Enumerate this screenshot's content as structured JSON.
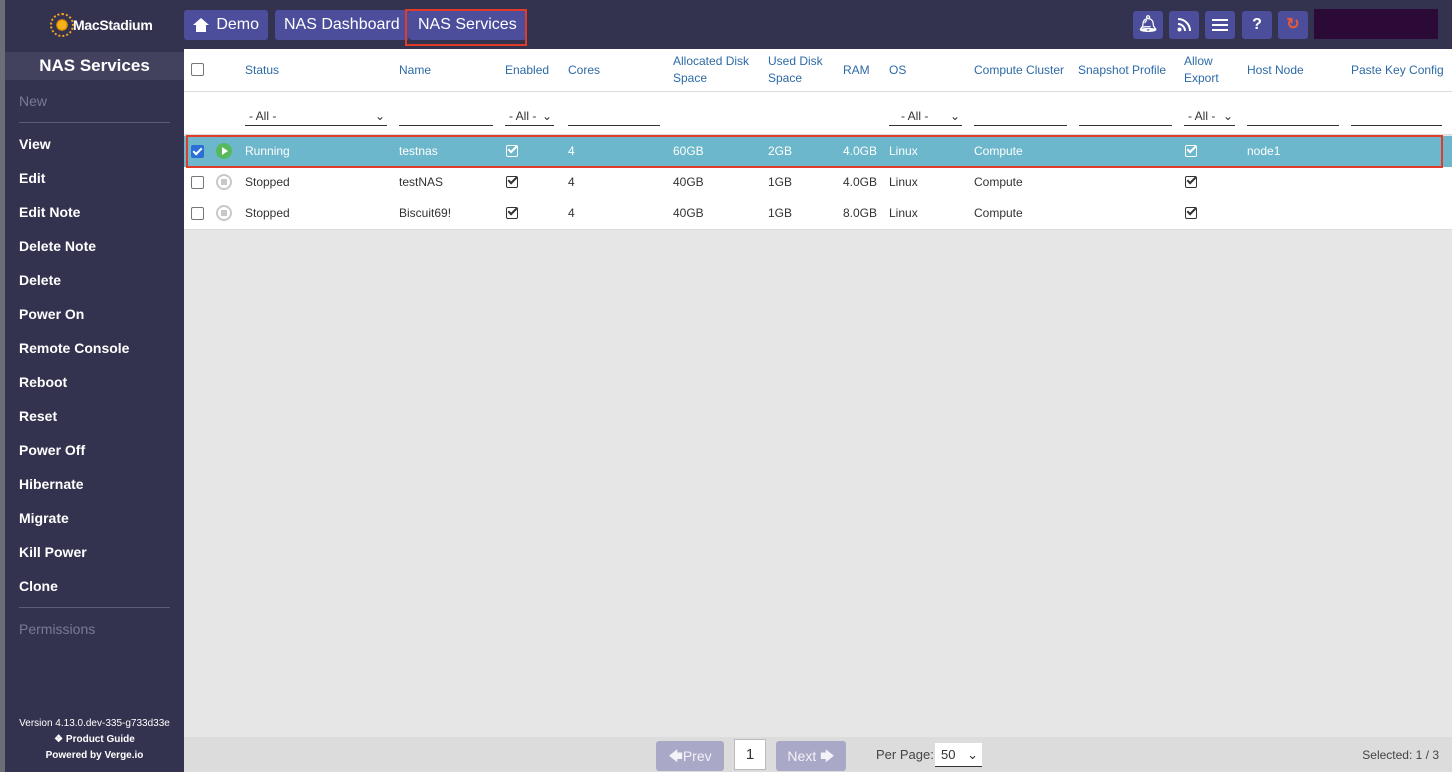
{
  "app": {
    "logo_text": "MacStadium"
  },
  "sidebar": {
    "title": "NAS Services",
    "new_label": "New",
    "items": [
      "View",
      "Edit",
      "Edit Note",
      "Delete Note",
      "Delete",
      "Power On",
      "Remote Console",
      "Reboot",
      "Reset",
      "Power Off",
      "Hibernate",
      "Migrate",
      "Kill Power",
      "Clone"
    ],
    "permissions_label": "Permissions",
    "version": "Version 4.13.0.dev-335-g733d33e",
    "product_guide": "Product Guide",
    "powered_by": "Powered by Verge.io"
  },
  "breadcrumbs": {
    "home": "Demo",
    "dashboard": "NAS Dashboard",
    "current": "NAS Services"
  },
  "toolbar_icons": [
    "bell-icon",
    "rss-icon",
    "list-icon",
    "help-icon",
    "refresh-icon"
  ],
  "toolbar": {
    "help_glyph": "?"
  },
  "table": {
    "headers": {
      "status": "Status",
      "name": "Name",
      "enabled": "Enabled",
      "cores": "Cores",
      "alloc_disk_1": "Allocated Disk",
      "alloc_disk_2": "Space",
      "used_disk_1": "Used Disk",
      "used_disk_2": "Space",
      "ram": "RAM",
      "os": "OS",
      "compute_cluster": "Compute Cluster",
      "snapshot_profile": "Snapshot Profile",
      "allow_export_1": "Allow",
      "allow_export_2": "Export",
      "host_node": "Host Node",
      "paste_key_config": "Paste Key Config"
    },
    "filters": {
      "status": "- All -",
      "enabled": "- All -",
      "os": "- All -",
      "allow_export": "- All -"
    },
    "rows": [
      {
        "selected": true,
        "status": "Running",
        "name": "testnas",
        "cores": "4",
        "alloc": "60GB",
        "used": "2GB",
        "ram": "4.0GB",
        "os": "Linux",
        "cluster": "Compute",
        "host": "node1"
      },
      {
        "selected": false,
        "status": "Stopped",
        "name": "testNAS",
        "cores": "4",
        "alloc": "40GB",
        "used": "1GB",
        "ram": "4.0GB",
        "os": "Linux",
        "cluster": "Compute",
        "host": ""
      },
      {
        "selected": false,
        "status": "Stopped",
        "name": "Biscuit69!",
        "cores": "4",
        "alloc": "40GB",
        "used": "1GB",
        "ram": "8.0GB",
        "os": "Linux",
        "cluster": "Compute",
        "host": ""
      }
    ]
  },
  "pagination": {
    "prev": "Prev",
    "page": "1",
    "next": "Next",
    "per_page_label": "Per Page:",
    "per_page_value": "50",
    "selected": "Selected: 1 / 3"
  },
  "colors": {
    "sidebar": "#34334f",
    "accent": "#4c4e9b",
    "selected_row": "#6cb7cb",
    "highlight": "#e13c2a"
  }
}
